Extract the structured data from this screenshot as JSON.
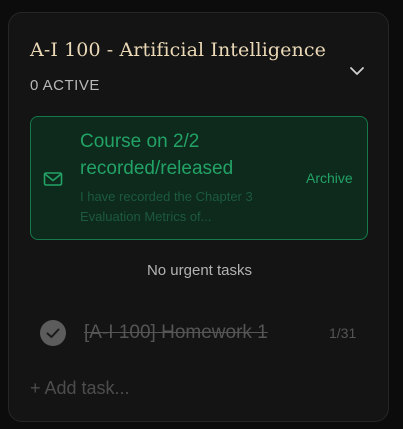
{
  "course": {
    "title": "A-I 100 - Artificial Intelligence",
    "active_count": "0 ACTIVE"
  },
  "announcement": {
    "title": "Course on 2/2 recorded/released",
    "body": "I have recorded the Chapter 3 Evaluation Metrics of...",
    "archive_label": "Archive",
    "icon": "mail-icon"
  },
  "urgent": {
    "empty_text": "No urgent tasks"
  },
  "tasks": [
    {
      "title": "[A-I 100] Homework 1",
      "due": "1/31",
      "completed": true
    }
  ],
  "add_task_label": "+ Add task...",
  "colors": {
    "accent_green": "#23a266",
    "title_cream": "#ead8b6",
    "card_bg": "#141414"
  }
}
